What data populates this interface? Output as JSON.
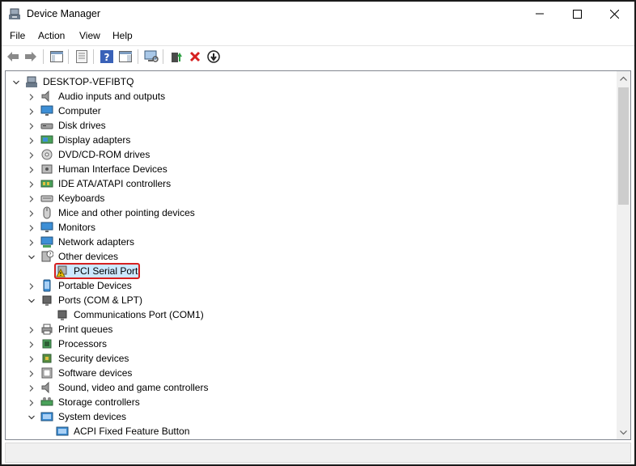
{
  "window": {
    "title": "Device Manager",
    "icon": "device-manager-icon"
  },
  "menu": [
    "File",
    "Action",
    "View",
    "Help"
  ],
  "toolbar": {
    "buttons": [
      "back-arrow-icon",
      "forward-arrow-icon",
      "show-hide-console-tree-icon",
      "properties-icon",
      "help-icon",
      "action-pane-icon",
      "scan-hardware-icon",
      "update-driver-icon",
      "uninstall-device-icon",
      "disable-device-icon"
    ]
  },
  "tree": {
    "root": "DESKTOP-VEFIBTQ",
    "items": [
      {
        "label": "Audio inputs and outputs",
        "expanded": false,
        "icon": "speaker-icon"
      },
      {
        "label": "Computer",
        "expanded": false,
        "icon": "monitor-icon"
      },
      {
        "label": "Disk drives",
        "expanded": false,
        "icon": "disk-drive-icon"
      },
      {
        "label": "Display adapters",
        "expanded": false,
        "icon": "display-adapter-icon"
      },
      {
        "label": "DVD/CD-ROM drives",
        "expanded": false,
        "icon": "dvd-icon"
      },
      {
        "label": "Human Interface Devices",
        "expanded": false,
        "icon": "hid-icon"
      },
      {
        "label": "IDE ATA/ATAPI controllers",
        "expanded": false,
        "icon": "ide-controller-icon"
      },
      {
        "label": "Keyboards",
        "expanded": false,
        "icon": "keyboard-icon"
      },
      {
        "label": "Mice and other pointing devices",
        "expanded": false,
        "icon": "mouse-icon"
      },
      {
        "label": "Monitors",
        "expanded": false,
        "icon": "monitor-icon"
      },
      {
        "label": "Network adapters",
        "expanded": false,
        "icon": "network-adapter-icon"
      },
      {
        "label": "Other devices",
        "expanded": true,
        "icon": "unknown-device-icon"
      },
      {
        "label": "PCI Serial Port",
        "child": true,
        "icon": "warning-device-icon",
        "highlighted": true
      },
      {
        "label": "Portable Devices",
        "expanded": false,
        "icon": "portable-device-icon"
      },
      {
        "label": "Ports (COM & LPT)",
        "expanded": true,
        "icon": "port-icon"
      },
      {
        "label": "Communications Port (COM1)",
        "child": true,
        "icon": "port-icon"
      },
      {
        "label": "Print queues",
        "expanded": false,
        "icon": "printer-icon"
      },
      {
        "label": "Processors",
        "expanded": false,
        "icon": "processor-icon"
      },
      {
        "label": "Security devices",
        "expanded": false,
        "icon": "security-chip-icon"
      },
      {
        "label": "Software devices",
        "expanded": false,
        "icon": "software-device-icon"
      },
      {
        "label": "Sound, video and game controllers",
        "expanded": false,
        "icon": "speaker-icon"
      },
      {
        "label": "Storage controllers",
        "expanded": false,
        "icon": "storage-controller-icon"
      },
      {
        "label": "System devices",
        "expanded": true,
        "icon": "system-device-icon"
      },
      {
        "label": "ACPI Fixed Feature Button",
        "child": true,
        "icon": "system-device-icon"
      }
    ]
  },
  "colors": {
    "highlight_border": "#d62020",
    "selection_fill": "#cce8ff"
  }
}
